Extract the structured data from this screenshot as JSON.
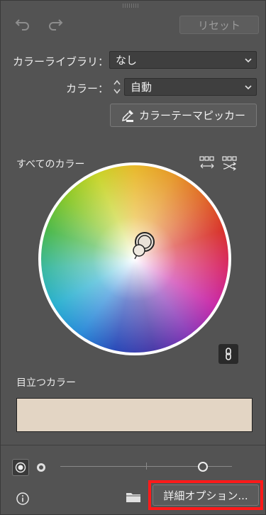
{
  "toolbar": {
    "undo_icon": "undo-icon",
    "redo_icon": "redo-icon",
    "reset_label": "リセット"
  },
  "library": {
    "label": "カラーライブラリ：",
    "value": "なし"
  },
  "colors": {
    "label": "カラー：",
    "value": "自動"
  },
  "picker_button": {
    "label": "カラーテーマピッカー"
  },
  "all_colors": {
    "label": "すべてのカラー"
  },
  "wheel": {
    "center_handle": "base-color-handle"
  },
  "prominent": {
    "label": "目立つカラー",
    "swatch_color": "#e3d5c4"
  },
  "bottom": {
    "brightness_level": 0.83,
    "details_label": "詳細オプション..."
  },
  "colors_theme": {
    "panel_bg": "#535353",
    "highlight": "#ff1a1a"
  }
}
